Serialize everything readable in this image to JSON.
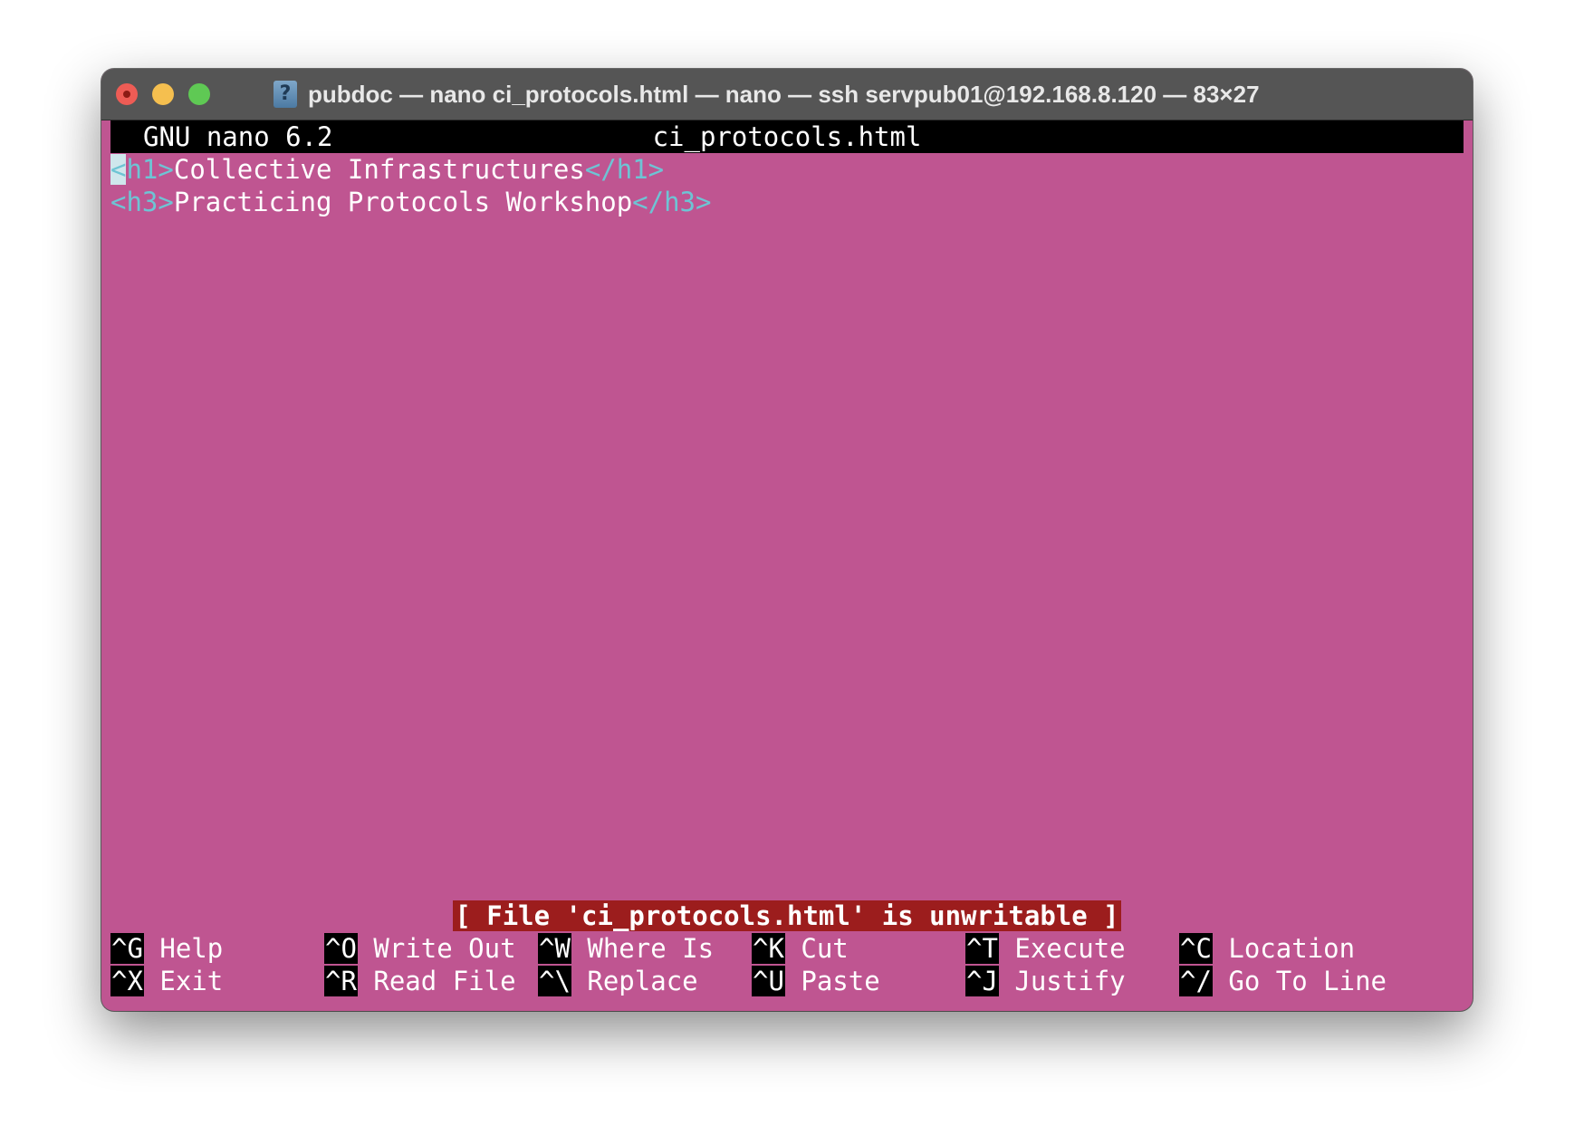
{
  "window": {
    "title": "pubdoc — nano ci_protocols.html — nano — ssh servpub01@192.168.8.120 — 83×27",
    "icon": "document-question-icon"
  },
  "nano": {
    "version": "GNU nano 6.2",
    "filename": "ci_protocols.html",
    "lines": [
      {
        "open": "<h1>",
        "text": "Collective Infrastructures",
        "close": "</h1>"
      },
      {
        "open": "<h3>",
        "text": "Practicing Protocols Workshop",
        "close": "</h3>"
      }
    ],
    "status": "[ File 'ci_protocols.html' is unwritable ]",
    "shortcuts": [
      {
        "key": "^G",
        "label": "Help"
      },
      {
        "key": "^O",
        "label": "Write Out"
      },
      {
        "key": "^W",
        "label": "Where Is"
      },
      {
        "key": "^K",
        "label": "Cut"
      },
      {
        "key": "^T",
        "label": "Execute"
      },
      {
        "key": "^C",
        "label": "Location"
      },
      {
        "key": "^X",
        "label": "Exit"
      },
      {
        "key": "^R",
        "label": "Read File"
      },
      {
        "key": "^\\",
        "label": "Replace"
      },
      {
        "key": "^U",
        "label": "Paste"
      },
      {
        "key": "^J",
        "label": "Justify"
      },
      {
        "key": "^/",
        "label": "Go To Line"
      }
    ]
  },
  "colors": {
    "background": "#bf5591",
    "tag": "#6ec4d4",
    "status_bg": "#9c1d1d",
    "titlebar": "#555555"
  }
}
